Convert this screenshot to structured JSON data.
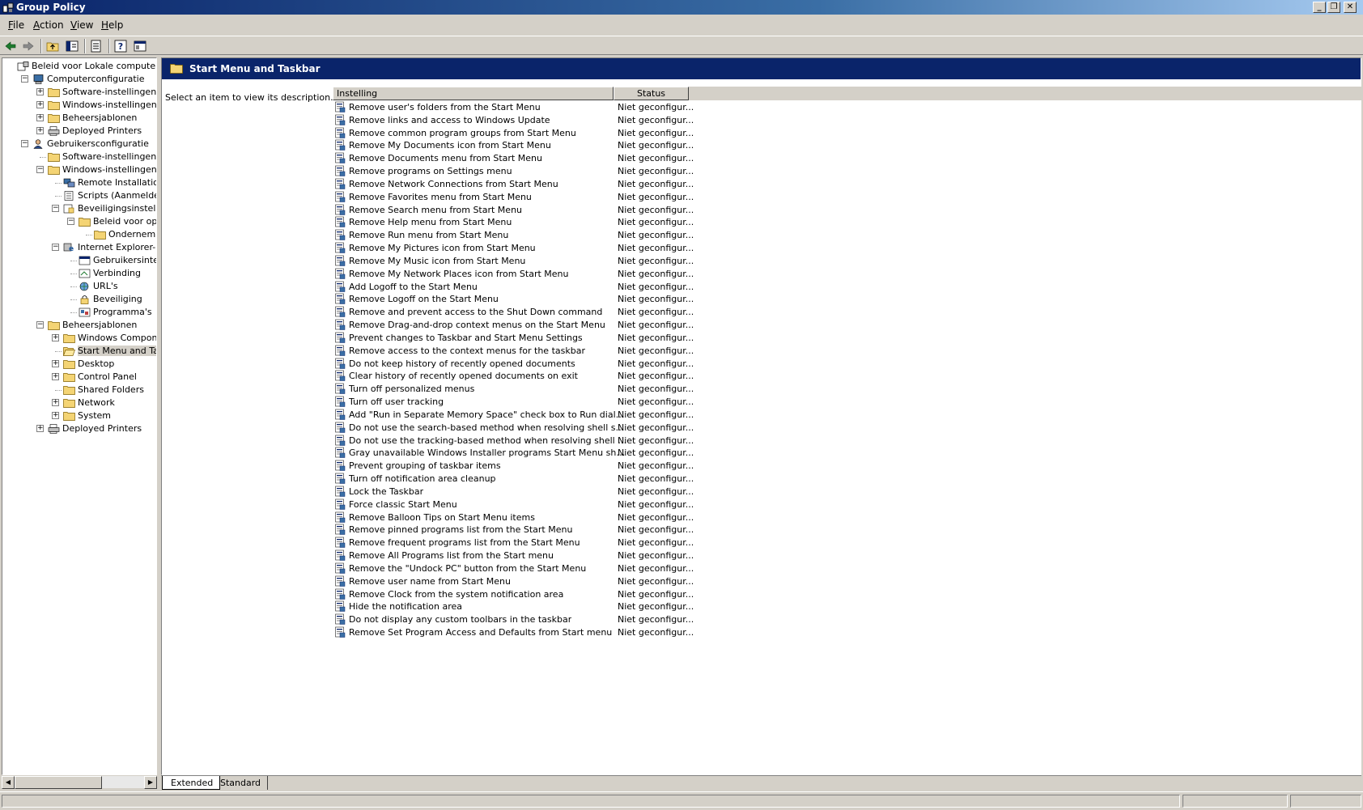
{
  "window": {
    "title": "Group Policy",
    "buttons": {
      "minimize": "_",
      "restore": "❐",
      "close": "✕"
    }
  },
  "menubar": [
    {
      "label": "File",
      "mnemonic": "F",
      "rest": "ile"
    },
    {
      "label": "Action",
      "mnemonic": "A",
      "rest": "ction"
    },
    {
      "label": "View",
      "mnemonic": "V",
      "rest": "iew"
    },
    {
      "label": "Help",
      "mnemonic": "H",
      "rest": "elp"
    }
  ],
  "toolbar": {
    "icons": [
      "back-arrow-icon",
      "forward-arrow-icon",
      "up-folder-icon",
      "show-hide-tree-icon",
      "export-list-icon",
      "help-icon",
      "properties-icon"
    ]
  },
  "tree": {
    "nodes": [
      {
        "label": "Beleid voor Lokale computer",
        "level": 0,
        "expander": "",
        "icon": "policy-computer-icon"
      },
      {
        "label": "Computerconfiguratie",
        "level": 1,
        "expander": "−",
        "icon": "computer-icon"
      },
      {
        "label": "Software-instellingen",
        "level": 2,
        "expander": "+",
        "icon": "folder-icon"
      },
      {
        "label": "Windows-instellingen",
        "level": 2,
        "expander": "+",
        "icon": "folder-icon"
      },
      {
        "label": "Beheersjablonen",
        "level": 2,
        "expander": "+",
        "icon": "folder-icon"
      },
      {
        "label": "Deployed Printers",
        "level": 2,
        "expander": "+",
        "icon": "printer-icon"
      },
      {
        "label": "Gebruikersconfiguratie",
        "level": 1,
        "expander": "−",
        "icon": "user-icon"
      },
      {
        "label": "Software-instellingen",
        "level": 2,
        "expander": "",
        "icon": "folder-icon"
      },
      {
        "label": "Windows-instellingen",
        "level": 2,
        "expander": "−",
        "icon": "folder-icon"
      },
      {
        "label": "Remote Installation Ser",
        "level": 3,
        "expander": "",
        "icon": "remote-install-icon"
      },
      {
        "label": "Scripts (Aanmelden/Afr",
        "level": 3,
        "expander": "",
        "icon": "script-icon"
      },
      {
        "label": "Beveiligingsinstellingen",
        "level": 3,
        "expander": "−",
        "icon": "security-icon"
      },
      {
        "label": "Beleid voor openba",
        "level": 4,
        "expander": "−",
        "icon": "folder-icon"
      },
      {
        "label": "Ondernemings",
        "level": 5,
        "expander": "",
        "icon": "folder-icon"
      },
      {
        "label": "Internet Explorer-onde",
        "level": 3,
        "expander": "−",
        "icon": "ie-maintenance-icon"
      },
      {
        "label": "Gebruikersinterface",
        "level": 4,
        "expander": "",
        "icon": "ui-icon"
      },
      {
        "label": "Verbinding",
        "level": 4,
        "expander": "",
        "icon": "connection-icon"
      },
      {
        "label": "URL's",
        "level": 4,
        "expander": "",
        "icon": "url-icon"
      },
      {
        "label": "Beveiliging",
        "level": 4,
        "expander": "",
        "icon": "lock-icon"
      },
      {
        "label": "Programma's",
        "level": 4,
        "expander": "",
        "icon": "programs-icon"
      },
      {
        "label": "Beheersjablonen",
        "level": 2,
        "expander": "−",
        "icon": "folder-icon"
      },
      {
        "label": "Windows Components",
        "level": 3,
        "expander": "+",
        "icon": "folder-icon"
      },
      {
        "label": "Start Menu and Taskba",
        "level": 3,
        "expander": "",
        "icon": "folder-open-icon",
        "selected": true
      },
      {
        "label": "Desktop",
        "level": 3,
        "expander": "+",
        "icon": "folder-icon"
      },
      {
        "label": "Control Panel",
        "level": 3,
        "expander": "+",
        "icon": "folder-icon"
      },
      {
        "label": "Shared Folders",
        "level": 3,
        "expander": "",
        "icon": "folder-icon"
      },
      {
        "label": "Network",
        "level": 3,
        "expander": "+",
        "icon": "folder-icon"
      },
      {
        "label": "System",
        "level": 3,
        "expander": "+",
        "icon": "folder-icon"
      },
      {
        "label": "Deployed Printers",
        "level": 2,
        "expander": "+",
        "icon": "printer-icon"
      }
    ]
  },
  "details": {
    "header_title": "Start Menu and Taskbar",
    "description": "Select an item to view its description.",
    "columns": {
      "setting": "Instelling",
      "status": "Status"
    },
    "rows": [
      {
        "name": "Remove user's folders from the Start Menu",
        "status": "Niet geconfigur..."
      },
      {
        "name": "Remove links and access to Windows Update",
        "status": "Niet geconfigur..."
      },
      {
        "name": "Remove common program groups from Start Menu",
        "status": "Niet geconfigur..."
      },
      {
        "name": "Remove My Documents icon from Start Menu",
        "status": "Niet geconfigur..."
      },
      {
        "name": "Remove Documents menu from Start Menu",
        "status": "Niet geconfigur..."
      },
      {
        "name": "Remove programs on Settings menu",
        "status": "Niet geconfigur..."
      },
      {
        "name": "Remove Network Connections from Start Menu",
        "status": "Niet geconfigur..."
      },
      {
        "name": "Remove Favorites menu from Start Menu",
        "status": "Niet geconfigur..."
      },
      {
        "name": "Remove Search menu from Start Menu",
        "status": "Niet geconfigur..."
      },
      {
        "name": "Remove Help menu from Start Menu",
        "status": "Niet geconfigur..."
      },
      {
        "name": "Remove Run menu from Start Menu",
        "status": "Niet geconfigur..."
      },
      {
        "name": "Remove My Pictures icon from Start Menu",
        "status": "Niet geconfigur..."
      },
      {
        "name": "Remove My Music icon from Start Menu",
        "status": "Niet geconfigur..."
      },
      {
        "name": "Remove My Network Places icon from Start Menu",
        "status": "Niet geconfigur..."
      },
      {
        "name": "Add Logoff to the Start Menu",
        "status": "Niet geconfigur..."
      },
      {
        "name": "Remove Logoff on the Start Menu",
        "status": "Niet geconfigur..."
      },
      {
        "name": "Remove and prevent access to the Shut Down command",
        "status": "Niet geconfigur..."
      },
      {
        "name": "Remove Drag-and-drop context menus on the Start Menu",
        "status": "Niet geconfigur..."
      },
      {
        "name": "Prevent changes to Taskbar and Start Menu Settings",
        "status": "Niet geconfigur..."
      },
      {
        "name": "Remove access to the context menus for the taskbar",
        "status": "Niet geconfigur..."
      },
      {
        "name": "Do not keep history of recently opened documents",
        "status": "Niet geconfigur..."
      },
      {
        "name": "Clear history of recently opened documents on exit",
        "status": "Niet geconfigur..."
      },
      {
        "name": "Turn off personalized menus",
        "status": "Niet geconfigur..."
      },
      {
        "name": "Turn off user tracking",
        "status": "Niet geconfigur..."
      },
      {
        "name": "Add \"Run in Separate Memory Space\" check box to Run dialog box",
        "status": "Niet geconfigur..."
      },
      {
        "name": "Do not use the search-based method when resolving shell shortcuts",
        "status": "Niet geconfigur..."
      },
      {
        "name": "Do not use the tracking-based method when resolving shell short...",
        "status": "Niet geconfigur..."
      },
      {
        "name": "Gray unavailable Windows Installer programs Start Menu shortcuts",
        "status": "Niet geconfigur..."
      },
      {
        "name": "Prevent grouping of taskbar items",
        "status": "Niet geconfigur..."
      },
      {
        "name": "Turn off notification area cleanup",
        "status": "Niet geconfigur..."
      },
      {
        "name": "Lock the Taskbar",
        "status": "Niet geconfigur..."
      },
      {
        "name": "Force classic Start Menu",
        "status": "Niet geconfigur..."
      },
      {
        "name": "Remove Balloon Tips on Start Menu items",
        "status": "Niet geconfigur..."
      },
      {
        "name": "Remove pinned programs list from the Start Menu",
        "status": "Niet geconfigur..."
      },
      {
        "name": "Remove frequent programs list from the Start Menu",
        "status": "Niet geconfigur..."
      },
      {
        "name": "Remove All Programs list from the Start menu",
        "status": "Niet geconfigur..."
      },
      {
        "name": "Remove the \"Undock PC\" button from the Start Menu",
        "status": "Niet geconfigur..."
      },
      {
        "name": "Remove user name from Start Menu",
        "status": "Niet geconfigur..."
      },
      {
        "name": "Remove Clock from the system notification area",
        "status": "Niet geconfigur..."
      },
      {
        "name": "Hide the notification area",
        "status": "Niet geconfigur..."
      },
      {
        "name": "Do not display any custom toolbars in the taskbar",
        "status": "Niet geconfigur..."
      },
      {
        "name": "Remove Set Program Access and Defaults from Start menu",
        "status": "Niet geconfigur..."
      }
    ]
  },
  "tabs": [
    {
      "label": "Extended",
      "active": true
    },
    {
      "label": "Standard",
      "active": false
    }
  ],
  "colors": {
    "title_gradient_start": "#0a246a",
    "header_bg": "#0a246a",
    "chrome": "#d4d0c8",
    "folder": "#f4d474"
  }
}
